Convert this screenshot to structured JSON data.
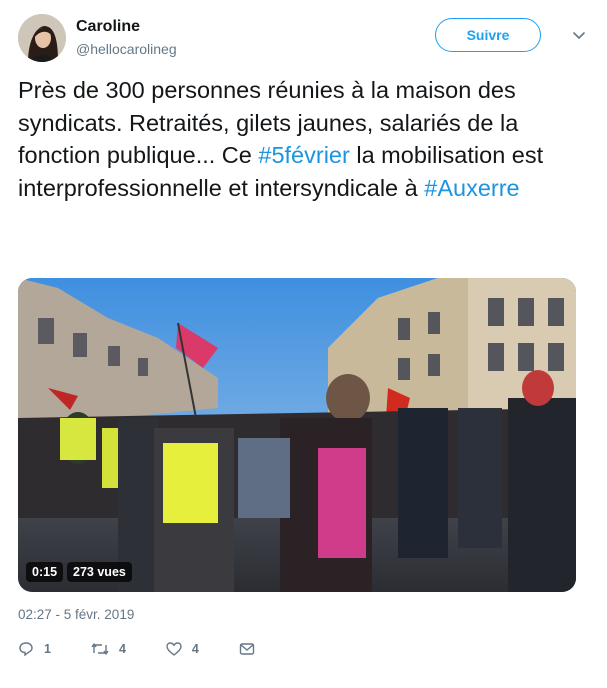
{
  "author": {
    "name": "Caroline",
    "handle": "@hellocarolineg",
    "avatar_icon": "profile-photo"
  },
  "follow_button": {
    "label": "Suivre"
  },
  "menu_icon": "chevron-down-icon",
  "tweet": {
    "text_part1": "Près de 300 personnes réunies à la maison des syndicats. Retraités, gilets jaunes, salariés de la fonction publique... Ce ",
    "hashtag1": "#5février",
    "text_part2": " la mobilisation est interprofessionnelle et intersyndicale à ",
    "hashtag2": "#Auxerre",
    "hashtag_color": "#1b95e0"
  },
  "media": {
    "duration": "0:15",
    "views": "273 vues"
  },
  "timestamp": "02:27 - 5 févr. 2019",
  "actions": {
    "reply_count": "1",
    "retweet_count": "4",
    "like_count": "4"
  },
  "colors": {
    "accent": "#1da1f2",
    "secondary_text": "#657786",
    "primary_text": "#14171a"
  }
}
